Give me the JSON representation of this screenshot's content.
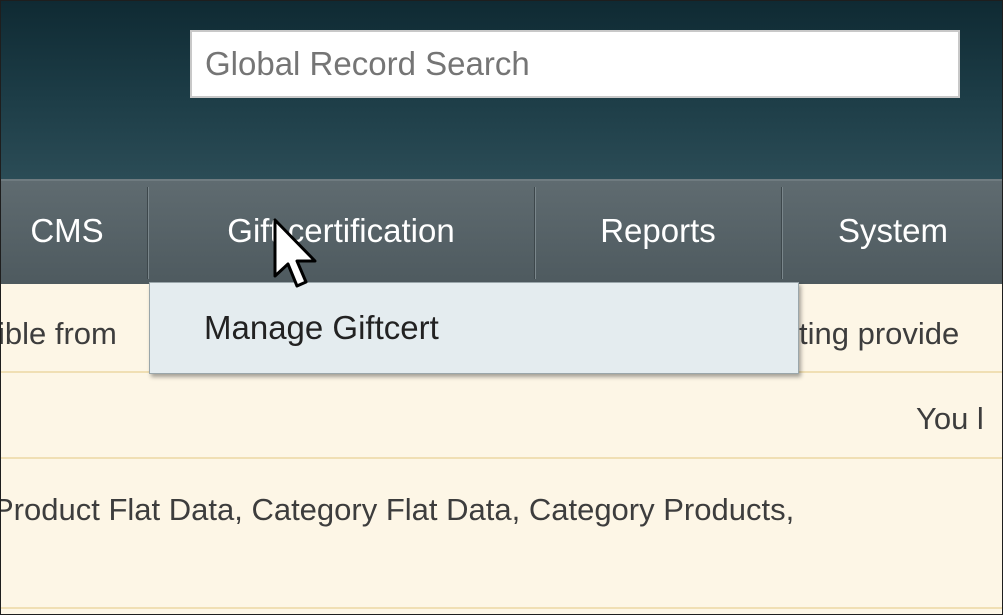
{
  "header": {
    "search": {
      "placeholder": "Global Record Search",
      "value": ""
    }
  },
  "nav": {
    "items": [
      "CMS",
      "Gift certification",
      "Reports",
      "System"
    ]
  },
  "dropdown": {
    "items": [
      "Manage Giftcert"
    ]
  },
  "content": {
    "row1_left": "ible from",
    "row1_right": "ting provide",
    "row2_right": "You l",
    "row3": "Product Flat Data, Category Flat Data, Category Products,"
  },
  "icons": {
    "cursor": "mouse-pointer-icon"
  },
  "colors": {
    "header_dark": "#0f2a33",
    "nav_bg": "#55626a",
    "content_bg": "#fdf6e6",
    "dropdown_bg": "#e4ecef"
  }
}
